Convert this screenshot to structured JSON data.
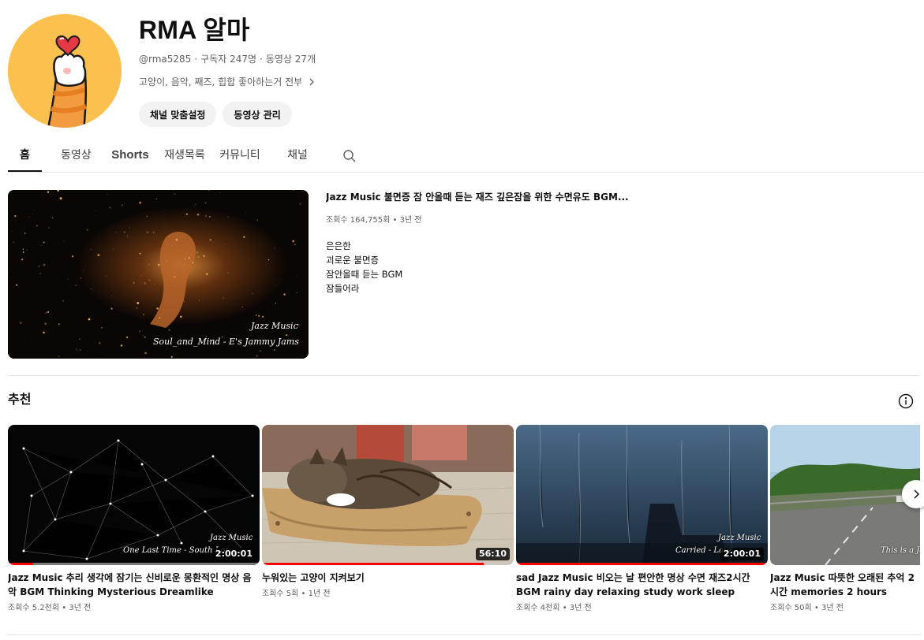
{
  "channel": {
    "name": "RMA 알마",
    "handle": "@rma5285",
    "subscribers": "구독자 247명",
    "video_count": "동영상 27개",
    "separator": "·",
    "description": "고양이, 음악, 째즈, 힙합 좋아하는거 전부",
    "customize_button": "채널 맞춤설정",
    "manage_videos_button": "동영상 관리",
    "avatar_icon": "cat-paw-heart-icon",
    "avatar_color": "#fcc04f"
  },
  "tabs": [
    {
      "label": "홈",
      "active": true
    },
    {
      "label": "동영상",
      "active": false
    },
    {
      "label": "Shorts",
      "active": false
    },
    {
      "label": "재생목록",
      "active": false
    },
    {
      "label": "커뮤니티",
      "active": false
    },
    {
      "label": "채널",
      "active": false
    }
  ],
  "featured": {
    "title": "Jazz Music 불면증 잠 안올때 듣는 재즈 깊은잠을 위한 수면유도 BGM...",
    "meta": "조회수 164,755회 • 3년 전",
    "description_lines": [
      "은은한",
      "괴로운 불면증",
      "잠안올때 듣는 BGM",
      "잠들어라"
    ],
    "thumb_caption_1": "Jazz Music",
    "thumb_caption_2": "Soul_and_Mind - E's Jammy Jams"
  },
  "section": {
    "title": "추천"
  },
  "videos": [
    {
      "title": "Jazz Music 추리 생각에 잠기는 신비로운 몽환적인 명상 음악 BGM Thinking Mysterious Dreamlike Meditation",
      "meta": "조회수 5.2천회 • 3년 전",
      "duration": "2:00:01",
      "progress": 0.1,
      "caption_1": "Jazz Music",
      "caption_2": "One Last Time - South Lor"
    },
    {
      "title": "누워있는 고양이 지켜보기",
      "meta": "조회수 5회 • 1년 전",
      "duration": "56:10",
      "progress": 0.88
    },
    {
      "title": "sad Jazz Music 비오는 날 편안한 명상 수면 재즈2시간 BGM rainy day relaxing study work sleep",
      "meta": "조회수 4천회 • 3년 전",
      "duration": "2:00:01",
      "progress": 0.99,
      "caption_1": "Jazz Music",
      "caption_2": "Carried - Laur"
    },
    {
      "title": "Jazz Music 따뜻한 오래된 추억 2시간 memories 2 hours",
      "meta": "조회수 50회 • 3년 전",
      "caption_1": "This is a Ja"
    }
  ],
  "colors": {
    "accent": "#ff0000",
    "text_secondary": "#606060",
    "button_bg": "#f2f2f2"
  }
}
